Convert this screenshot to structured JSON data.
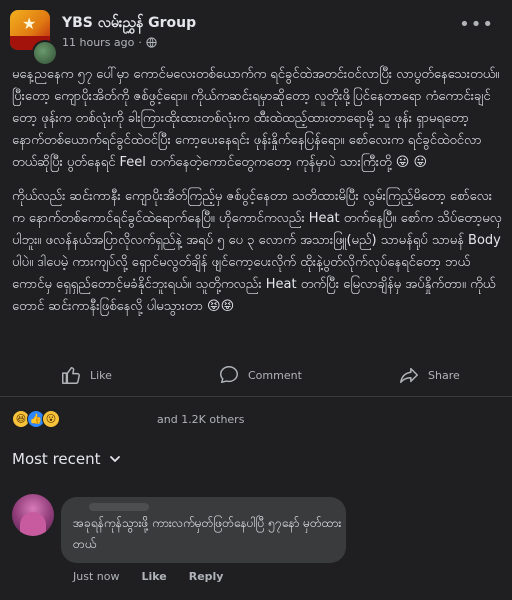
{
  "post": {
    "group_name": "YBS လမ်းညွှန် Group",
    "time": "11 hours ago",
    "meta_separator": "·",
    "more_icon": "more-horizontal-icon",
    "privacy_icon": "globe-icon",
    "paragraphs": [
      "မနေ့ညနေက ၅၇ ပေါ်မှာ ကောင်မလေးတစ်ယောက်က ရင်ခွင်ထဲအတင်းဝင်လာပြီး လာပွတ်နေသေးတယ်။ ပြီးတော့ ကျောပိုးအိတ်ကို ဇစ်ဖွင့်ရော။ ကိုယ်ကဆင်းရမှာဆိုတော့ လူတိုးဖို့ပြင်နေတာရော ကံကောင်းချင်တော့ ဖုန်းက တစ်လုံးကို ခါးကြားထိုးထားတစ်လုံးက ထီးထဲထည့်ထားတာရောမို့ သူ ဖုန်း ရှာမရတော့ နောက်တစ်ယောက်ရင်ခွင်ထဲဝင်ပြီး ကော့ပေးနေရင်း ဖုန်းနှိုက်နေပြန်ရော။ စော်လေးက ရင်ခွင်ထဲဝင်လာတယ်ဆိုပြီး ပွတ်နေရင် Feel တက်နေတဲ့ကောင်တွေကတော့ ကုန်မှာပဲ သားကြီးတို့ 😛 😛",
      "ကိုယ်လည်း ဆင်းကာနီး ကျောပိုးအိတ်ကြည့်မှ ဇစ်ပွင့်နေတာ သတိထားမိပြီး လွမ်းကြည့်မိတော့ စော်လေးက နောက်တစ်ကောင်ရင်ခွင်ထဲရောက်နေပြီ။ ဟိုကောင်ကလည်း Heat တက်နေပြီ။ စော်က သိပ်တော့မလှပါဘူး။ ဖလန်နယ်အပြာလိုလက်ရှည်နဲ့ အရပ် ၅ ပေ ၃ လောက် အသားဖြူ(မည်) သာမန်ရုပ် သာမန် Body ပါပဲ။ ဒါပေမဲ့ ကားကျပ်လို့ ရှောင်မလွတ်ချိန် ဖျင်ကော့ပေးလိုက် ထိုးနဲ့ပွတ်လိုက်လုပ်နေရင်တော့ ဘယ်ကောင်မှ ရှေရှည်တောင့်မခံနိုင်ဘူးရယ်။ သူတို့ကလည်း Heat တက်ပြီး မြေလာချိန်မှ အပ်နှိုက်တာ။ ကိုယ်တောင် ဆင်းကာနီးဖြစ်နေလို့ ပါမသွားတာ 😝😝"
    ],
    "actions": {
      "like": "Like",
      "comment": "Comment",
      "share": "Share"
    },
    "reactions": {
      "icons": [
        "haha-icon",
        "like-icon",
        "wow-icon"
      ],
      "count_text": "and 1.2K others"
    }
  },
  "comments": {
    "sort_label": "Most recent",
    "items": [
      {
        "text": "အခုရန်ကုန်သွားဖို့ ကားလက်မှတ်ဖြတ်နေပါပြီ ၅၇နော် မှတ်ထားတယ်",
        "time": "Just now",
        "like_label": "Like",
        "reply_label": "Reply"
      }
    ]
  },
  "colors": {
    "background": "#1f1f21",
    "text": "#e4e6eb",
    "secondary_text": "#b0b3b8",
    "bubble": "#3a3b3c"
  }
}
